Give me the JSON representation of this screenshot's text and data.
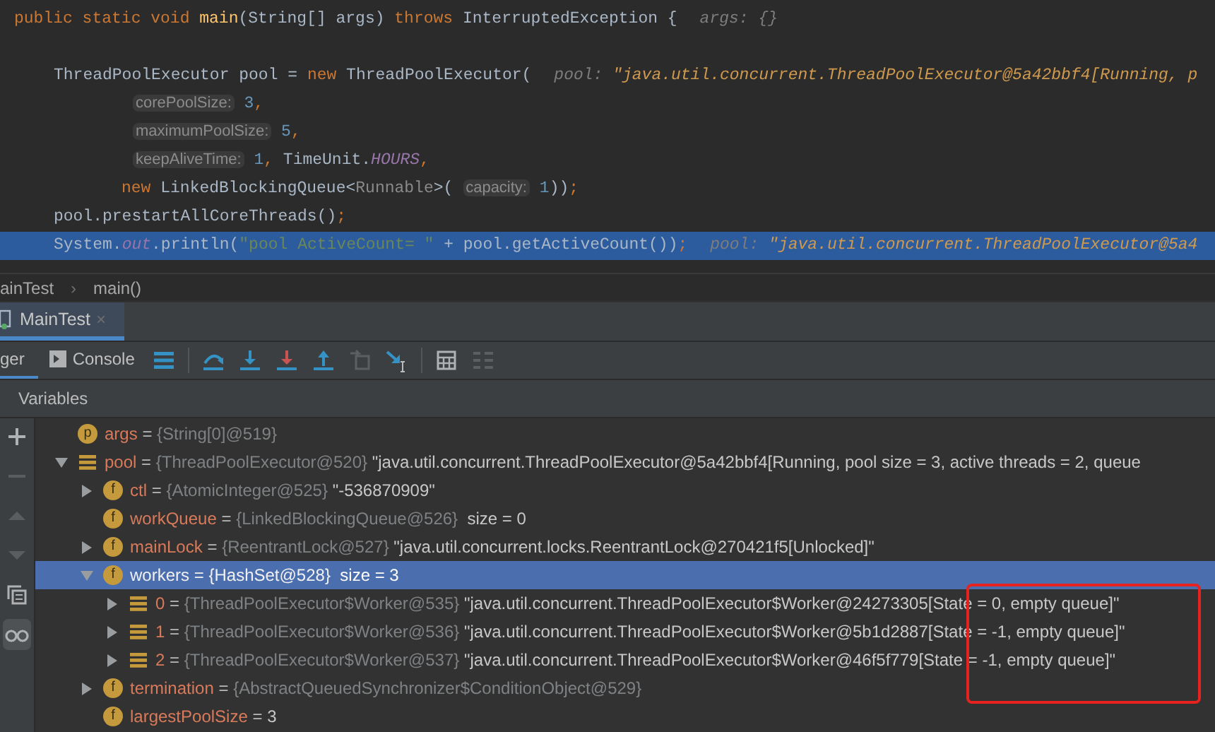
{
  "editor": {
    "lines": [
      {
        "kind": "signature",
        "current": false,
        "tokens": [
          {
            "kind": "kw",
            "text": "public static void "
          },
          {
            "kind": "method",
            "text": "main"
          },
          {
            "kind": "plain",
            "text": "(String[] args) "
          },
          {
            "kind": "kw",
            "text": "throws "
          },
          {
            "kind": "plain",
            "text": "InterruptedException {"
          }
        ],
        "inline_value": {
          "name": "args:",
          "value": "{}",
          "kind": "object"
        }
      },
      {
        "kind": "blank"
      },
      {
        "kind": "statement",
        "current": false,
        "tokens": [
          {
            "kind": "plain",
            "text": "ThreadPoolExecutor pool = "
          },
          {
            "kind": "kw",
            "text": "new "
          },
          {
            "kind": "plain",
            "text": "ThreadPoolExecutor("
          }
        ],
        "inline_value": {
          "name": "pool:",
          "value": "\"java.util.concurrent.ThreadPoolExecutor@5a42bbf4[Running, p",
          "kind": "string"
        }
      },
      {
        "kind": "argument",
        "current": false,
        "tokens": [
          {
            "kind": "hint",
            "text": "corePoolSize:"
          },
          {
            "kind": "num",
            "text": " 3"
          },
          {
            "kind": "kw",
            "text": ","
          }
        ]
      },
      {
        "kind": "argument",
        "current": false,
        "tokens": [
          {
            "kind": "hint",
            "text": "maximumPoolSize:"
          },
          {
            "kind": "num",
            "text": " 5"
          },
          {
            "kind": "kw",
            "text": ","
          }
        ]
      },
      {
        "kind": "argument",
        "current": false,
        "tokens": [
          {
            "kind": "hint",
            "text": "keepAliveTime:"
          },
          {
            "kind": "num",
            "text": " 1"
          },
          {
            "kind": "kw",
            "text": ", "
          },
          {
            "kind": "plain",
            "text": "TimeUnit."
          },
          {
            "kind": "const",
            "text": "HOURS"
          },
          {
            "kind": "kw",
            "text": ","
          }
        ]
      },
      {
        "kind": "continuation",
        "current": false,
        "tokens": [
          {
            "kind": "kw",
            "text": "new "
          },
          {
            "kind": "plain",
            "text": "LinkedBlockingQueue<"
          },
          {
            "kind": "type",
            "text": "Runnable"
          },
          {
            "kind": "plain",
            "text": ">( "
          },
          {
            "kind": "hint",
            "text": "capacity:"
          },
          {
            "kind": "num",
            "text": " 1"
          },
          {
            "kind": "plain",
            "text": "))"
          },
          {
            "kind": "kw",
            "text": ";"
          }
        ]
      },
      {
        "kind": "statement",
        "current": false,
        "tokens": [
          {
            "kind": "plain",
            "text": "pool.prestartAllCoreThreads()"
          },
          {
            "kind": "kw",
            "text": ";"
          }
        ]
      },
      {
        "kind": "statement",
        "current": true,
        "tokens": [
          {
            "kind": "plain",
            "text": "System."
          },
          {
            "kind": "const",
            "text": "out"
          },
          {
            "kind": "plain",
            "text": ".println("
          },
          {
            "kind": "str",
            "text": "\"pool ActiveCount= \""
          },
          {
            "kind": "plain",
            "text": " + pool.getActiveCount())"
          },
          {
            "kind": "kw",
            "text": ";"
          }
        ],
        "inline_value": {
          "name": "pool:",
          "value": "\"java.util.concurrent.ThreadPoolExecutor@5a4",
          "kind": "string"
        }
      }
    ]
  },
  "breadcrumb": [
    "ainTest",
    "main()"
  ],
  "breadcrumb_separator": "›",
  "session_tabs": [
    {
      "label": "MainTest",
      "close": "×",
      "selected": true
    }
  ],
  "debug_tabs": [
    {
      "label": "ger",
      "kind": "text",
      "selected": true
    },
    {
      "label": "Console",
      "kind": "console",
      "selected": false
    }
  ],
  "toolbar": [
    {
      "kind": "frames",
      "disabled": false
    },
    {
      "kind": "step-over",
      "disabled": false
    },
    {
      "kind": "step-into",
      "disabled": false
    },
    {
      "kind": "force-step-into",
      "disabled": false
    },
    {
      "kind": "step-out",
      "disabled": false
    },
    {
      "kind": "drop-frame",
      "disabled": true
    },
    {
      "kind": "run-to-cursor",
      "disabled": false
    },
    {
      "kind": "evaluate",
      "disabled": false
    },
    {
      "kind": "trace",
      "disabled": true
    }
  ],
  "variables": {
    "title": "Variables",
    "side_buttons": [
      {
        "kind": "plus",
        "disabled": false,
        "selected": false
      },
      {
        "kind": "minus",
        "disabled": true,
        "selected": false
      },
      {
        "kind": "up",
        "disabled": true,
        "selected": false
      },
      {
        "kind": "down",
        "disabled": true,
        "selected": false
      },
      {
        "kind": "copy",
        "disabled": false,
        "selected": false
      },
      {
        "kind": "watches",
        "disabled": false,
        "selected": true
      }
    ],
    "tree": [
      {
        "kind": "param",
        "badge": "p",
        "name": "args",
        "sep": "=",
        "type": "{String[0]@519}",
        "expandable": false,
        "selected": false
      },
      {
        "kind": "object",
        "name": "pool",
        "sep": "=",
        "type": "{ThreadPoolExecutor@520}",
        "value": "\"java.util.concurrent.ThreadPoolExecutor@5a42bbf4[Running, pool size = 3, active threads = 2, queue",
        "expandable": true,
        "expanded": true,
        "selected": false,
        "children": [
          {
            "kind": "field",
            "badge": "f",
            "name": "ctl",
            "sep": "=",
            "type": "{AtomicInteger@525}",
            "value": "\"-536870909\"",
            "expandable": true,
            "expanded": false,
            "selected": false
          },
          {
            "kind": "field",
            "badge": "f",
            "name": "workQueue",
            "sep": "=",
            "type": "{LinkedBlockingQueue@526}",
            "value": " size = 0",
            "expandable": false,
            "selected": false
          },
          {
            "kind": "field",
            "badge": "f",
            "name": "mainLock",
            "sep": "=",
            "type": "{ReentrantLock@527}",
            "value": "\"java.util.concurrent.locks.ReentrantLock@270421f5[Unlocked]\"",
            "expandable": true,
            "expanded": false,
            "selected": false
          },
          {
            "kind": "field",
            "badge": "f",
            "name": "workers",
            "sep": "=",
            "type": "{HashSet@528}",
            "value": " size = 3",
            "expandable": true,
            "expanded": true,
            "selected": true,
            "children": [
              {
                "kind": "object",
                "name": "0",
                "sep": "=",
                "type": "{ThreadPoolExecutor$Worker@535}",
                "value": "\"java.util.concurrent.ThreadPoolExecutor$Worker@24273305[State = 0, empty queue]\"",
                "expandable": true,
                "expanded": false,
                "selected": false
              },
              {
                "kind": "object",
                "name": "1",
                "sep": "=",
                "type": "{ThreadPoolExecutor$Worker@536}",
                "value": "\"java.util.concurrent.ThreadPoolExecutor$Worker@5b1d2887[State = -1, empty queue]\"",
                "expandable": true,
                "expanded": false,
                "selected": false
              },
              {
                "kind": "object",
                "name": "2",
                "sep": "=",
                "type": "{ThreadPoolExecutor$Worker@537}",
                "value": "\"java.util.concurrent.ThreadPoolExecutor$Worker@46f5f779[State = -1, empty queue]\"",
                "expandable": true,
                "expanded": false,
                "selected": false
              }
            ]
          },
          {
            "kind": "field",
            "badge": "f",
            "name": "termination",
            "sep": "=",
            "type": "{AbstractQueuedSynchronizer$ConditionObject@529}",
            "expandable": true,
            "expanded": false,
            "selected": false
          },
          {
            "kind": "field",
            "badge": "f",
            "name": "largestPoolSize",
            "sep": "=",
            "value": "3",
            "expandable": false,
            "selected": false
          }
        ]
      }
    ]
  },
  "highlight_box": true
}
